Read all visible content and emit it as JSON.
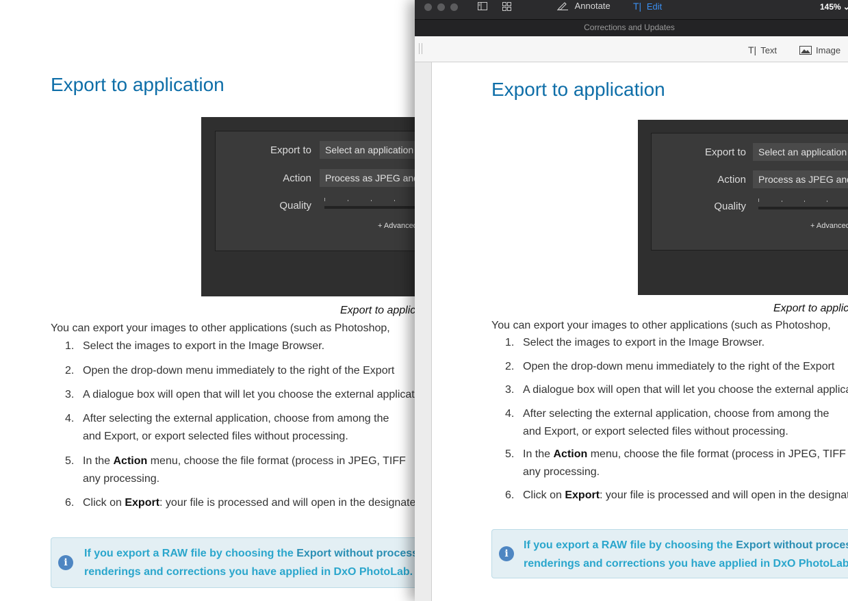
{
  "doc": {
    "title": "Export to application",
    "shot": {
      "export_label": "Export to",
      "export_value": "Select an application",
      "action_label": "Action",
      "action_value": "Process as JPEG and",
      "quality_label": "Quality",
      "advanced": "+ Advanced"
    },
    "caption": "Export to application",
    "intro": "You can export your images to other applications (such as Photoshop,",
    "steps": [
      {
        "num": "1.",
        "text": "Select the images to export in the Image Browser."
      },
      {
        "num": "2.",
        "text": "Open the drop-down menu   immediately to the right of the Export"
      },
      {
        "num": "3.",
        "text": "A dialogue box will open that will let you choose the external application"
      },
      {
        "num": "4.",
        "text": "After selecting the external application, choose from among the",
        "cont": "and Export, or export selected files without processing."
      },
      {
        "num": "5.",
        "pre": "In the ",
        "bold": "Action",
        "post": " menu, choose the file format (process in JPEG, TIFF",
        "cont": "any processing."
      },
      {
        "num": "6.",
        "pre": "Click on ",
        "bold": "Export",
        "post": ": your file is processed and will open in the designated"
      }
    ],
    "note": {
      "icon": "i",
      "line1_pre": "If you export a RAW file by choosing the ",
      "line1_bold": "Export without processing",
      "line2": "renderings and corrections you have applied in DxO PhotoLab."
    }
  },
  "window": {
    "toolbar": {
      "annotate_label": "Annotate",
      "edit_label": "Edit",
      "zoom": "145%",
      "zoom_chevron": "⌄"
    },
    "doc_title": "Corrections and Updates",
    "toolbar2": {
      "text_label": "Text",
      "image_label": "Image"
    }
  }
}
